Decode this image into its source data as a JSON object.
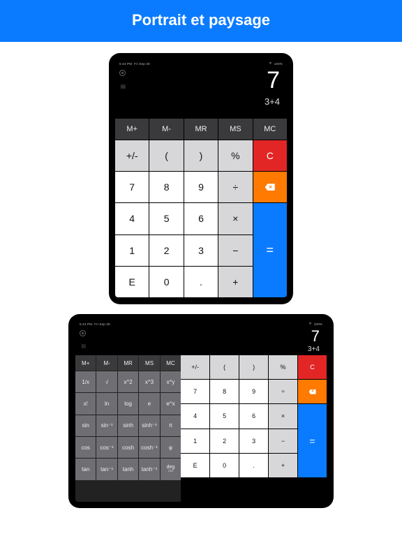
{
  "banner": {
    "title": "Portrait et paysage"
  },
  "status": {
    "time": "5:43 PM",
    "date": "Fri Sep 30",
    "wifi": "􀙇",
    "battery": "100%"
  },
  "display": {
    "result": "7",
    "expression": "3+4"
  },
  "mem": {
    "mp": "M+",
    "mm": "M-",
    "mr": "MR",
    "ms": "MS",
    "mc": "MC"
  },
  "row1": {
    "pm": "+/-",
    "lp": "(",
    "rp": ")",
    "pct": "%",
    "clr": "C"
  },
  "row2": {
    "k7": "7",
    "k8": "8",
    "k9": "9",
    "div": "÷"
  },
  "row3": {
    "k4": "4",
    "k5": "5",
    "k6": "6",
    "mul": "×"
  },
  "row4": {
    "k1": "1",
    "k2": "2",
    "k3": "3",
    "sub": "−"
  },
  "row5": {
    "ke": "E",
    "k0": "0",
    "kd": ".",
    "add": "+"
  },
  "eq": "=",
  "sci": {
    "r1": {
      "a": "1/x",
      "b": "√",
      "c": "x^2",
      "d": "x^3",
      "e": "x^y"
    },
    "r2": {
      "a": "x!",
      "b": "ln",
      "c": "log",
      "d": "e",
      "e": "e^x"
    },
    "r3": {
      "a": "sin",
      "b": "sin⁻¹",
      "c": "sinh",
      "d": "sinh⁻¹",
      "e": "π"
    },
    "r4": {
      "a": "cos",
      "b": "cos⁻¹",
      "c": "cosh",
      "d": "cosh⁻¹",
      "e": "φ"
    },
    "r5": {
      "a": "tan",
      "b": "tan⁻¹",
      "c": "tanh",
      "d": "tanh⁻¹",
      "e": "deg"
    },
    "r6": {
      "a": "",
      "b": "",
      "c": "",
      "d": "",
      "e": "rad"
    }
  }
}
